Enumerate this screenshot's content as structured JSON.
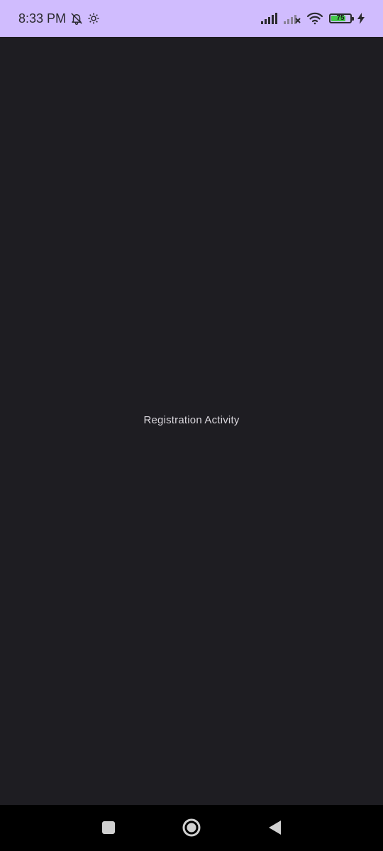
{
  "status_bar": {
    "time": "8:33 PM",
    "battery_level": "75",
    "battery_fraction": 0.75,
    "icons": [
      "bell-off-icon",
      "gear-icon",
      "signal-icon",
      "signal-no-service-icon",
      "wifi-icon",
      "battery-icon",
      "charging-icon"
    ]
  },
  "main": {
    "label": "Registration Activity"
  },
  "nav_bar": {
    "buttons": [
      "recents-button",
      "home-button",
      "back-button"
    ]
  },
  "colors": {
    "status_bar_bg": "#d0bcfe",
    "screen_bg": "#1e1d22",
    "text": "#d9d6dc",
    "battery_fill": "#44c94a",
    "nav_bar_bg": "#000000",
    "nav_icon": "#d0d0d0"
  }
}
